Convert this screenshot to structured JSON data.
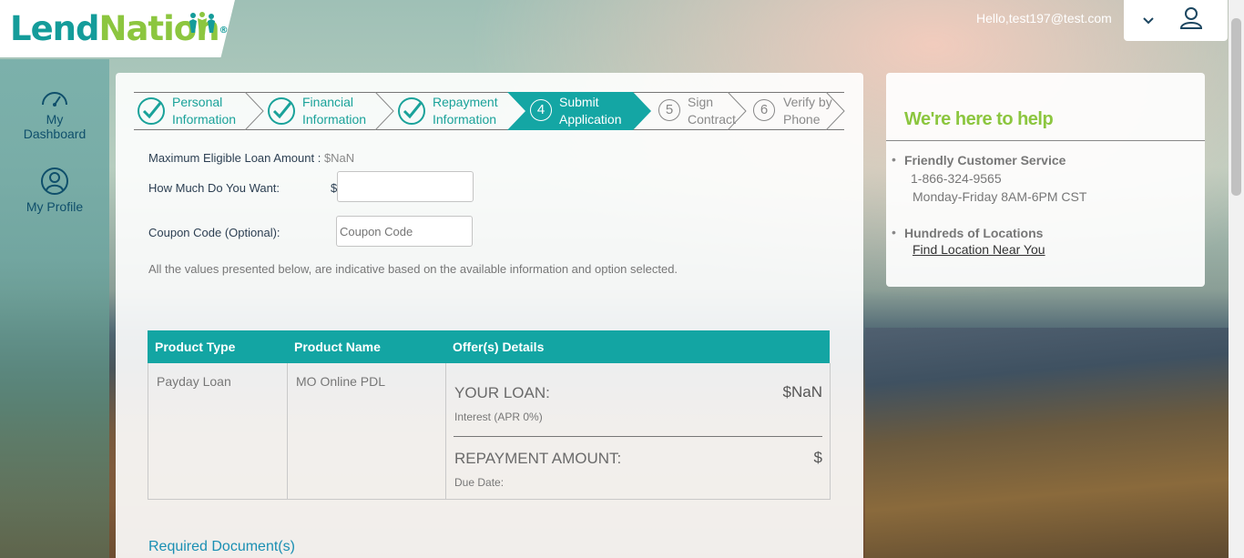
{
  "header": {
    "logo_lend": "Lend",
    "logo_nation": "Nation",
    "logo_reg": "®",
    "greeting": "Hello,test197@test.com"
  },
  "sidebar": {
    "items": [
      {
        "label_line1": "My",
        "label_line2": "Dashboard",
        "icon": "speedometer-icon"
      },
      {
        "label": "My Profile",
        "icon": "user-circle-icon"
      }
    ]
  },
  "steps": [
    {
      "line1": "Personal",
      "line2": "Information",
      "state": "done"
    },
    {
      "line1": "Financial",
      "line2": "Information",
      "state": "done"
    },
    {
      "line1": "Repayment",
      "line2": "Information",
      "state": "done"
    },
    {
      "number": "4",
      "line1": "Submit",
      "line2": "Application",
      "state": "active"
    },
    {
      "number": "5",
      "line1": "Sign",
      "line2": "Contract",
      "state": "pending"
    },
    {
      "number": "6",
      "line1": "Verify by",
      "line2": "Phone",
      "state": "pending"
    }
  ],
  "form": {
    "max_label": "Maximum Eligible Loan Amount :",
    "max_value": "$NaN",
    "amount_label": "How Much Do You Want:",
    "currency_symbol": "$",
    "amount_value": "",
    "coupon_label": "Coupon Code (Optional):",
    "coupon_placeholder": "Coupon Code",
    "note": "All the values presented below, are indicative based on the available information and option selected."
  },
  "table": {
    "headers": [
      "Product Type",
      "Product Name",
      "Offer(s) Details"
    ],
    "row": {
      "product_type": "Payday Loan",
      "product_name": "MO Online PDL",
      "your_loan_label": "YOUR LOAN:",
      "your_loan_value": "$NaN",
      "interest": "Interest (APR 0%)",
      "repayment_label": "REPAYMENT AMOUNT:",
      "repayment_value": "$",
      "due_date": "Due Date:"
    }
  },
  "required_docs": "Required Document(s)",
  "help": {
    "title": "We're here to help",
    "service_title": "Friendly Customer Service",
    "phone": "1-866-324-9565",
    "hours": "Monday-Friday 8AM-6PM CST",
    "locations_title": "Hundreds of Locations",
    "locations_link": "Find Location Near You"
  },
  "colors": {
    "teal": "#14a6a4",
    "green": "#8cc63f",
    "link_blue": "#1a8fb3"
  }
}
